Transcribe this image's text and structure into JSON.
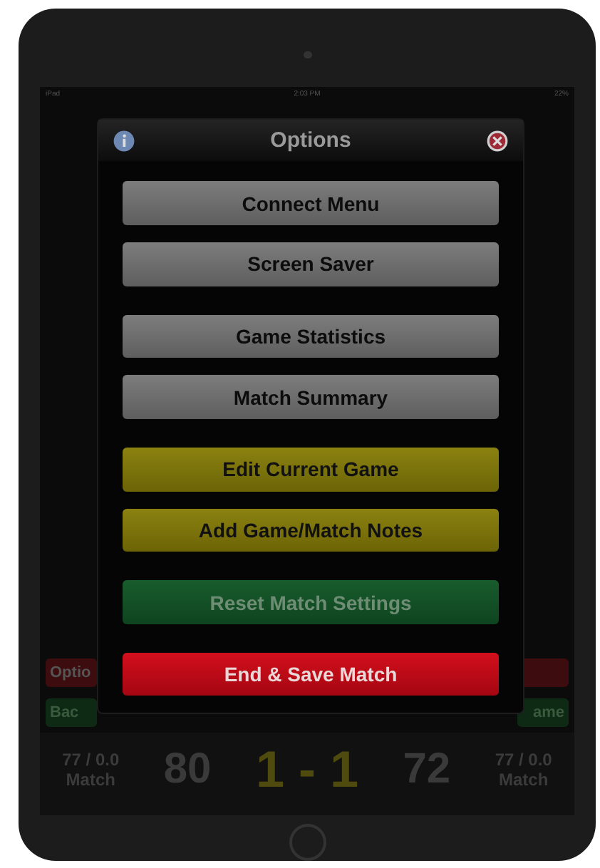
{
  "status_bar": {
    "device": "iPad",
    "time": "2:03 PM",
    "battery": "22%"
  },
  "left_buttons": [
    {
      "label": "Optio",
      "kind": "red"
    },
    {
      "label": "Bac",
      "kind": "green"
    }
  ],
  "right_buttons": [
    {
      "kind": "red"
    },
    {
      "label": "ame",
      "kind": "green"
    }
  ],
  "score_row": {
    "left_stats": "77 / 0.0",
    "left_stats_label": "Match",
    "left_score": "80",
    "match_score": "1 - 1",
    "right_score": "72",
    "right_stats": "77 / 0.0",
    "right_stats_label": "Match"
  },
  "dialog": {
    "title": "Options",
    "buttons": [
      {
        "label": "Connect Menu",
        "kind": "gray"
      },
      {
        "label": "Screen Saver",
        "kind": "gray"
      },
      {
        "label": "Game Statistics",
        "kind": "gray"
      },
      {
        "label": "Match Summary",
        "kind": "gray"
      },
      {
        "label": "Edit Current Game",
        "kind": "yellow"
      },
      {
        "label": "Add Game/Match Notes",
        "kind": "yellow"
      },
      {
        "label": "Reset Match Settings",
        "kind": "green"
      },
      {
        "label": "End & Save Match",
        "kind": "red"
      }
    ]
  }
}
